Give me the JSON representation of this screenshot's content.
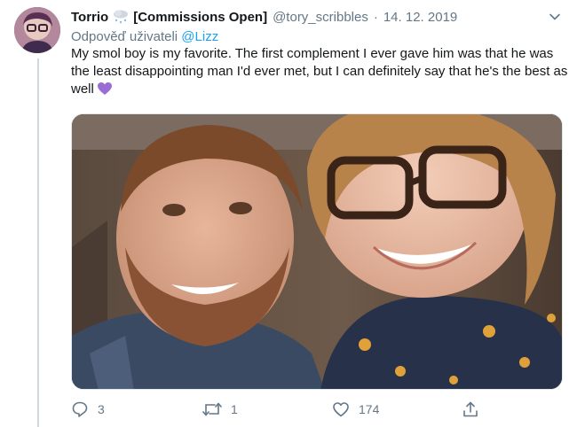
{
  "tweet": {
    "display_name": "Torrio",
    "name_suffix": "[Commissions Open]",
    "handle": "@tory_scribbles",
    "separator": "·",
    "date": "14. 12. 2019",
    "reply_prefix": "Odpověď uživateli",
    "reply_mention": "@Lizz",
    "text": "My smol boy is my favorite. The first complement I ever gave him was that he was the least disappointing man I'd ever met, but I can definitely say that he's the best as well"
  },
  "actions": {
    "reply_count": "3",
    "retweet_count": "1",
    "like_count": "174"
  },
  "icons": {
    "name_emoji": "cloud-snow-icon",
    "text_emoji": "purple-heart-icon",
    "reply": "reply-icon",
    "retweet": "retweet-icon",
    "like": "heart-icon",
    "share": "share-icon",
    "menu": "chevron-down-icon"
  },
  "colors": {
    "text": "#14171a",
    "secondary": "#657786",
    "link": "#1da1f2",
    "heart": "#9b6bd6"
  }
}
